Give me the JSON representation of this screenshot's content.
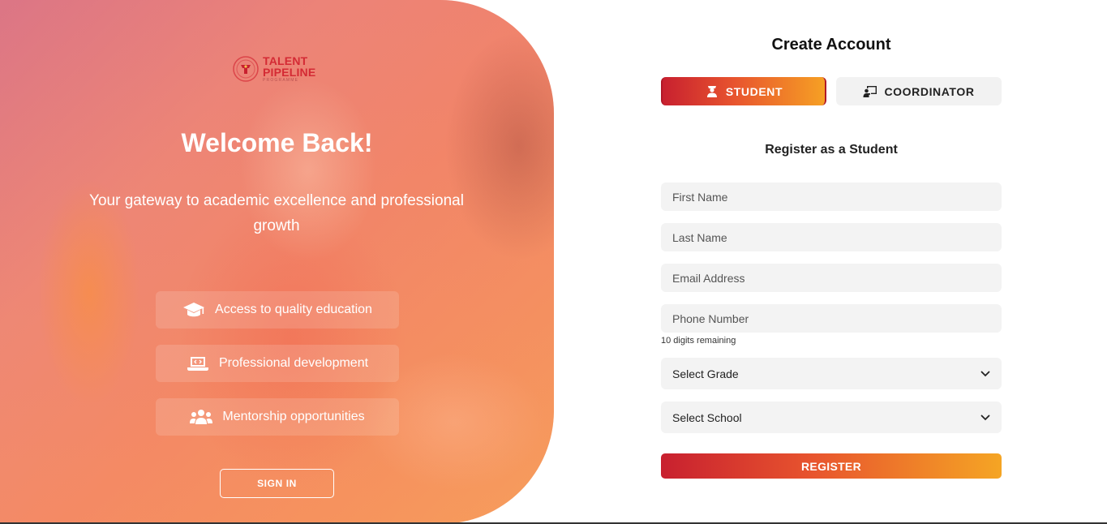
{
  "brand": {
    "logo_line1": "TALENT",
    "logo_line2": "PIPELINE",
    "logo_line3": "PROGRAMME",
    "primary_color": "#c8202f",
    "accent_color": "#f6a024"
  },
  "hero": {
    "heading": "Welcome Back!",
    "tagline": "Your gateway to academic excellence and professional growth",
    "features": [
      {
        "icon": "graduation-cap-icon",
        "label": "Access to quality education"
      },
      {
        "icon": "laptop-code-icon",
        "label": "Professional development"
      },
      {
        "icon": "users-icon",
        "label": "Mentorship opportunities"
      }
    ],
    "signin_label": "SIGN IN"
  },
  "form": {
    "title": "Create Account",
    "roles": [
      {
        "icon": "student-icon",
        "label": "STUDENT",
        "selected": true
      },
      {
        "icon": "chalkboard-teacher-icon",
        "label": "COORDINATOR",
        "selected": false
      }
    ],
    "subtitle": "Register as a Student",
    "first_name_placeholder": "First Name",
    "last_name_placeholder": "Last Name",
    "email_placeholder": "Email Address",
    "phone_placeholder": "Phone Number",
    "phone_hint": "10 digits remaining",
    "grade_select": "Select Grade",
    "school_select": "Select School",
    "register_label": "REGISTER"
  }
}
